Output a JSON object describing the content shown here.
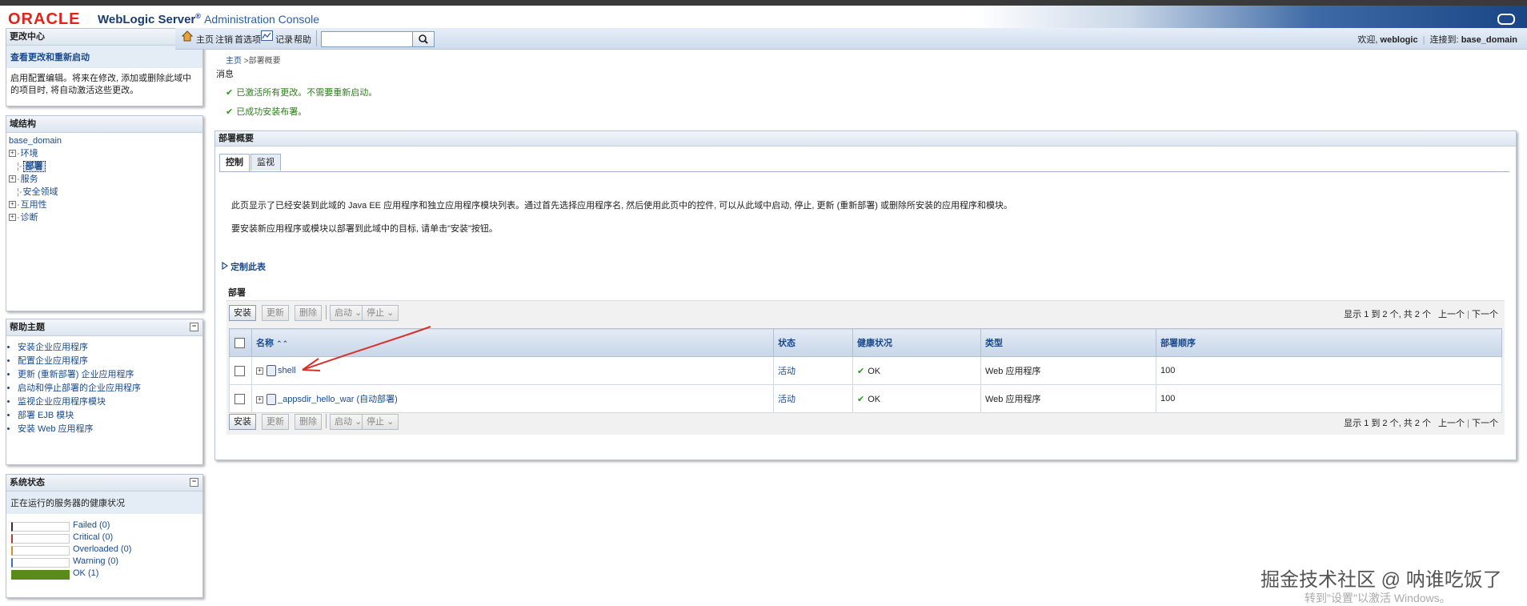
{
  "header": {
    "oracle": "ORACLE",
    "product": "WebLogic Server",
    "registered": "®",
    "console": "Administration Console"
  },
  "change_center": {
    "title": "更改中心",
    "subtitle": "查看更改和重新启动",
    "text": "启用配置编辑。将来在修改, 添加或删除此域中的项目时, 将自动激活这些更改。"
  },
  "domain_structure": {
    "title": "域结构",
    "root": "base_domain",
    "items": [
      {
        "label": "环境",
        "expandable": true
      },
      {
        "label": "部署",
        "expandable": false,
        "selected": true
      },
      {
        "label": "服务",
        "expandable": true
      },
      {
        "label": "安全领域",
        "expandable": false
      },
      {
        "label": "互用性",
        "expandable": true
      },
      {
        "label": "诊断",
        "expandable": true
      }
    ]
  },
  "help_topics": {
    "title": "帮助主题",
    "items": [
      "安装企业应用程序",
      "配置企业应用程序",
      "更新 (重新部署) 企业应用程序",
      "启动和停止部署的企业应用程序",
      "监视企业应用程序模块",
      "部署 EJB 模块",
      "安装 Web 应用程序"
    ]
  },
  "system_status": {
    "title": "系统状态",
    "subtitle": "正在运行的服务器的健康状况",
    "rows": [
      {
        "label": "Failed (0)",
        "color": "#333333",
        "fill": 0
      },
      {
        "label": "Critical (0)",
        "color": "#c0392b",
        "fill": 0
      },
      {
        "label": "Overloaded (0)",
        "color": "#e08a2a",
        "fill": 0
      },
      {
        "label": "Warning (0)",
        "color": "#3a72c4",
        "fill": 0
      },
      {
        "label": "OK (1)",
        "color": "#5a8a1a",
        "fill": 1
      }
    ]
  },
  "toolbar": {
    "home": "主页",
    "logout": "注销",
    "preferences": "首选项",
    "record": "记录",
    "help": "帮助",
    "search_value": "",
    "welcome_prefix": "欢迎, ",
    "user": "weblogic",
    "connected_prefix": "连接到: ",
    "domain": "base_domain"
  },
  "breadcrumb": {
    "home": "主页",
    "sep": " >",
    "current": "部署概要"
  },
  "messages": {
    "title": "消息",
    "lines": [
      "已激活所有更改。不需要重新启动。",
      "已成功安装布署。"
    ]
  },
  "main": {
    "title": "部署概要",
    "tabs": [
      "控制",
      "监视"
    ],
    "desc1": "此页显示了已经安装到此域的 Java EE 应用程序和独立应用程序模块列表。通过首先选择应用程序名, 然后使用此页中的控件, 可以从此域中启动, 停止, 更新 (重新部署) 或删除所安装的应用程序和模块。",
    "desc2": "要安装新应用程序或模块以部署到此域中的目标, 请单击\"安装\"按钮。",
    "customize": "定制此表",
    "section": "部署",
    "buttons": {
      "install": "安装",
      "update": "更新",
      "delete": "删除",
      "start": "启动",
      "stop": "停止"
    },
    "pager": {
      "range": "显示 1 到 2 个, 共 2 个",
      "prev": "上一个",
      "sep": "|",
      "next": "下一个"
    },
    "columns": [
      "名称",
      "状态",
      "健康状况",
      "类型",
      "部署顺序"
    ],
    "rows": [
      {
        "name": "shell",
        "state": "活动",
        "health": "OK",
        "type": "Web 应用程序",
        "order": "100"
      },
      {
        "name": "_appsdir_hello_war (自动部署)",
        "state": "活动",
        "health": "OK",
        "type": "Web 应用程序",
        "order": "100"
      }
    ]
  },
  "watermark": {
    "line1": "掘金技术社区 @ 呐谁吃饭了",
    "line2": "转到\"设置\"以激活 Windows。"
  }
}
